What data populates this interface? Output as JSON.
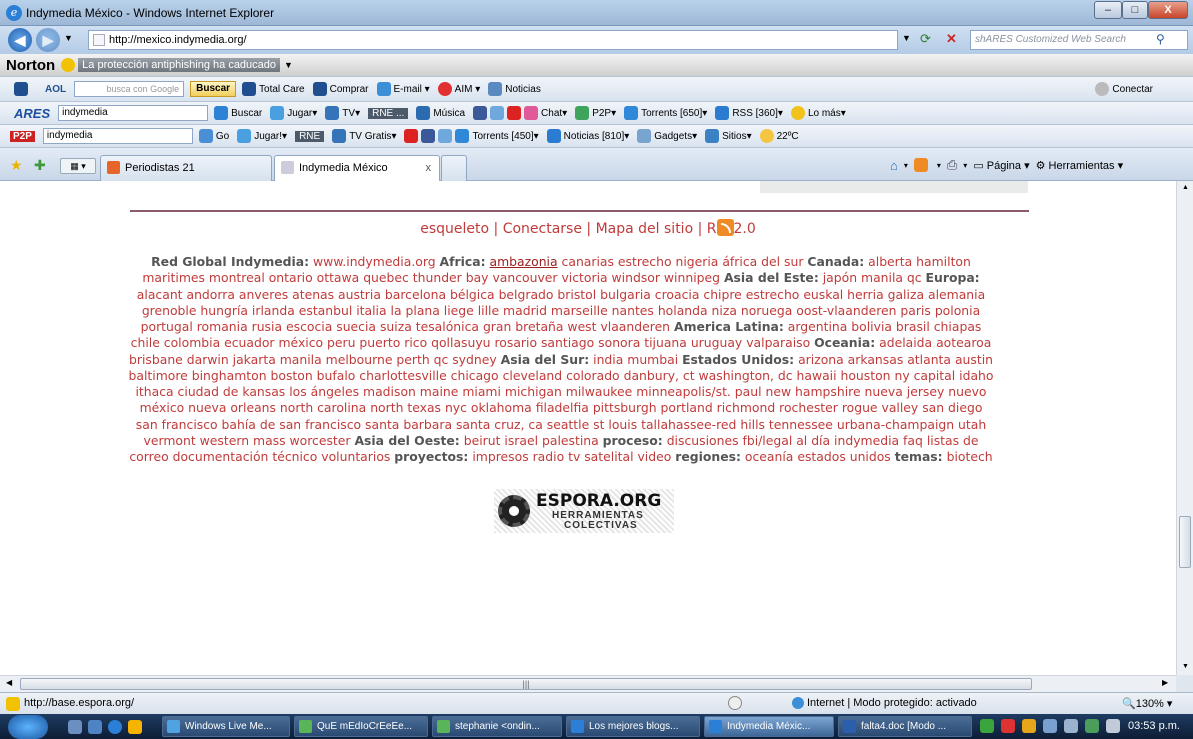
{
  "window": {
    "title": "Indymedia México - Windows Internet Explorer",
    "minimize": "–",
    "maximize": "□",
    "close": "X"
  },
  "address": {
    "url": "http://mexico.indymedia.org/",
    "search_placeholder": "shARES Customized Web Search"
  },
  "norton": {
    "brand": "Norton",
    "warning": "La protección antiphishing ha caducado"
  },
  "aol": {
    "brand": "AOL",
    "search_hint": "busca con Google",
    "buscar": "Buscar",
    "items": [
      "Total Care",
      "Comprar",
      "E-mail",
      "AIM",
      "Noticias"
    ],
    "connect": "Conectar"
  },
  "ares": {
    "brand": "ARES",
    "query": "indymedia",
    "items": [
      "Buscar",
      "Jugar",
      "TV",
      "RNE ...",
      "Música",
      "Chat",
      "P2P",
      "Torrents [650]",
      "RSS [360]",
      "Lo más"
    ]
  },
  "p2p": {
    "brand": "P2P",
    "query": "indymedia",
    "items": [
      "Go",
      "Jugar!",
      "RNE",
      "TV Gratis",
      "Torrents [450]",
      "Noticias [810]",
      "Gadgets",
      "Sitios",
      "22ºC"
    ]
  },
  "tabs": [
    {
      "label": "Periodistas 21"
    },
    {
      "label": "Indymedia México"
    }
  ],
  "tab_close": "x",
  "cmdbar": {
    "page": "Página",
    "tools": "Herramientas"
  },
  "nav": {
    "skeleton": "esqueleto",
    "sep1": " | ",
    "login": "Conectarse",
    "sep2": " | ",
    "sitemap": "Mapa del sitio",
    "sep3": " | ",
    "rss_r": "R",
    "rss_ver": "2.0"
  },
  "links": {
    "h_global": "Red Global Indymedia:",
    "t_global": " www.indymedia.org ",
    "h_africa": "Africa:",
    "t_africa_u": "ambazonia",
    "t_africa": " canarias estrecho nigeria áfrica del sur ",
    "h_canada": "Canada:",
    "t_canada": " alberta hamilton maritimes montreal ontario ottawa quebec thunder bay vancouver victoria windsor winnipeg ",
    "h_asia_este": "Asia del Este:",
    "t_asia_este": " japón manila qc ",
    "h_europa": "Europa:",
    "t_europa": " alacant andorra anveres atenas austria barcelona bélgica belgrado bristol bulgaria croacia chipre estrecho euskal herria galiza alemania grenoble hungría irlanda estanbul italia la plana liege lille madrid marseille nantes holanda niza noruega oost-vlaanderen paris polonia portugal romania rusia escocia suecia suiza tesalónica gran bretaña west vlaanderen ",
    "h_america": "America Latina:",
    "t_america": " argentina bolivia brasil chiapas chile colombia ecuador méxico peru puerto rico qollasuyu rosario santiago sonora tijuana uruguay valparaiso ",
    "h_oceania": "Oceania:",
    "t_oceania": " adelaida aotearoa brisbane darwin jakarta manila melbourne perth qc sydney ",
    "h_asia_sur": "Asia del Sur:",
    "t_asia_sur": " india mumbai ",
    "h_eeuu": "Estados Unidos:",
    "t_eeuu": " arizona arkansas atlanta austin baltimore binghamton boston bufalo charlottesville chicago cleveland colorado danbury, ct washington, dc hawaii houston ny capital idaho ithaca ciudad de kansas los ángeles madison maine miami michigan milwaukee minneapolis/st. paul new hampshire nueva jersey nuevo méxico nueva orleans north carolina north texas nyc oklahoma filadelfia pittsburgh portland richmond rochester rogue valley san diego san francisco bahía de san francisco santa barbara santa cruz, ca seattle st louis tallahassee-red hills tennessee urbana-champaign utah vermont western mass worcester ",
    "h_asia_oeste": "Asia del Oeste:",
    "t_asia_oeste": " beirut israel palestina ",
    "h_proceso": "proceso:",
    "t_proceso": " discusiones fbi/legal al día indymedia faq listas de correo documentación técnico voluntarios ",
    "h_proyectos": "proyectos:",
    "t_proyectos": " impresos radio tv satelital video ",
    "h_regiones": "regiones:",
    "t_regiones": " oceanía estados unidos ",
    "h_temas": "temas:",
    "t_temas": " biotech"
  },
  "espora": {
    "title": "ESPORA.ORG",
    "line2": "HERRAMIENTAS",
    "line3": "COLECTIVAS"
  },
  "status": {
    "url": "http://base.espora.org/",
    "zone": "Internet | Modo protegido: activado",
    "zoom": "130%"
  },
  "taskbar": {
    "items": [
      "Windows Live Me...",
      "QuE mEdIoCrEeEe...",
      "stephanie <ondin...",
      "Los mejores blogs...",
      "Indymedia Méxic...",
      "falta4.doc [Modo ..."
    ],
    "clock": "03:53 p.m."
  },
  "colors": {
    "link": "#c13b3b",
    "heading": "#555555",
    "rule": "#8d5c6b",
    "rss": "#f08a24"
  }
}
